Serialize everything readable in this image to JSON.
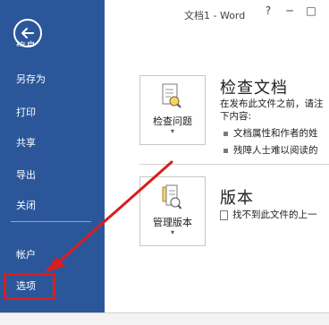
{
  "window": {
    "title": "文档1 - Word",
    "controls": [
      "?",
      "─",
      "□",
      "✕"
    ]
  },
  "sidebar": {
    "back_icon": "back-arrow-icon",
    "clipped_label": "信息",
    "items": [
      {
        "label": "另存为"
      },
      {
        "label": "打印"
      },
      {
        "label": "共享"
      },
      {
        "label": "导出"
      },
      {
        "label": "关闭"
      },
      {
        "label": "帐户"
      },
      {
        "label": "选项"
      }
    ]
  },
  "inspect": {
    "button_label": "检查问题",
    "title": "检查文档",
    "desc_line1": "在发布此文件之前，请注",
    "desc_line2": "下内容:",
    "bullet1": "文档属性和作者的姓",
    "bullet2": "残障人士难以阅读的"
  },
  "version": {
    "button_label": "管理版本",
    "title": "版本",
    "text": "找不到此文件的上一"
  },
  "annotation": {
    "color": "#d81e1e"
  }
}
